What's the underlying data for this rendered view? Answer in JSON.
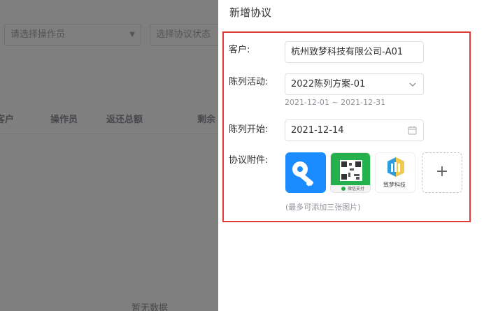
{
  "background": {
    "operator_placeholder": "请选择操作员",
    "status_placeholder": "选择协议状态",
    "columns": [
      "客户",
      "操作员",
      "返还总额",
      "剩余"
    ],
    "empty_text": "暂无数据"
  },
  "drawer": {
    "title": "新增协议",
    "customer": {
      "label": "客户:",
      "value": "杭州致梦科技有限公司-A01"
    },
    "display_activity": {
      "label": "陈列活动:",
      "value": "2022陈列方案-01",
      "range": "2021-12-01 ~ 2021-12-31"
    },
    "start": {
      "label": "陈列开始:",
      "value": "2021-12-14"
    },
    "attachments": {
      "label": "协议附件:",
      "hint": "(最多可添加三张图片)",
      "images": [
        {
          "icon": "key-app-icon"
        },
        {
          "icon": "wechat-qr-icon",
          "caption": "微信支付"
        },
        {
          "icon": "zhimeng-logo",
          "caption": "致梦科技"
        }
      ],
      "add_symbol": "+"
    }
  },
  "colors": {
    "accent_red": "#e53935",
    "blue": "#1a8cff",
    "green": "#22b14c"
  }
}
